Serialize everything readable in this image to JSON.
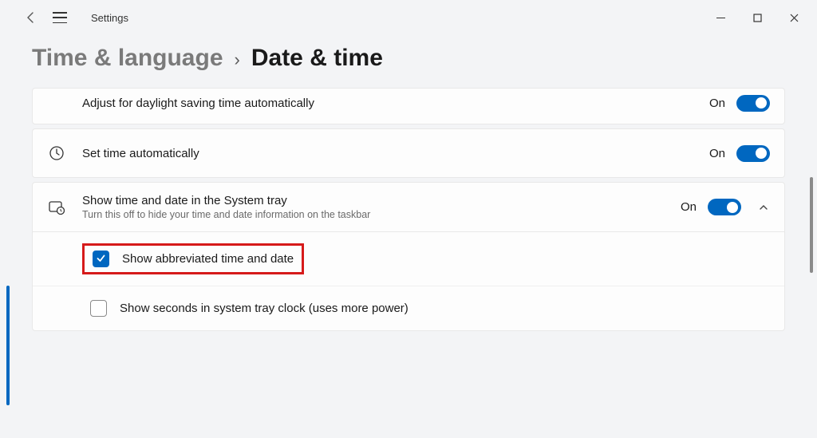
{
  "window": {
    "app_title": "Settings"
  },
  "breadcrumb": {
    "parent": "Time & language",
    "separator": "›",
    "current": "Date & time"
  },
  "rows": {
    "dst": {
      "label": "Adjust for daylight saving time automatically",
      "state": "On"
    },
    "set_auto": {
      "label": "Set time automatically",
      "state": "On"
    },
    "systray": {
      "label": "Show time and date in the System tray",
      "sub": "Turn this off to hide your time and date information on the taskbar",
      "state": "On"
    },
    "abbrev": {
      "label": "Show abbreviated time and date"
    },
    "seconds": {
      "label": "Show seconds in system tray clock (uses more power)"
    }
  }
}
